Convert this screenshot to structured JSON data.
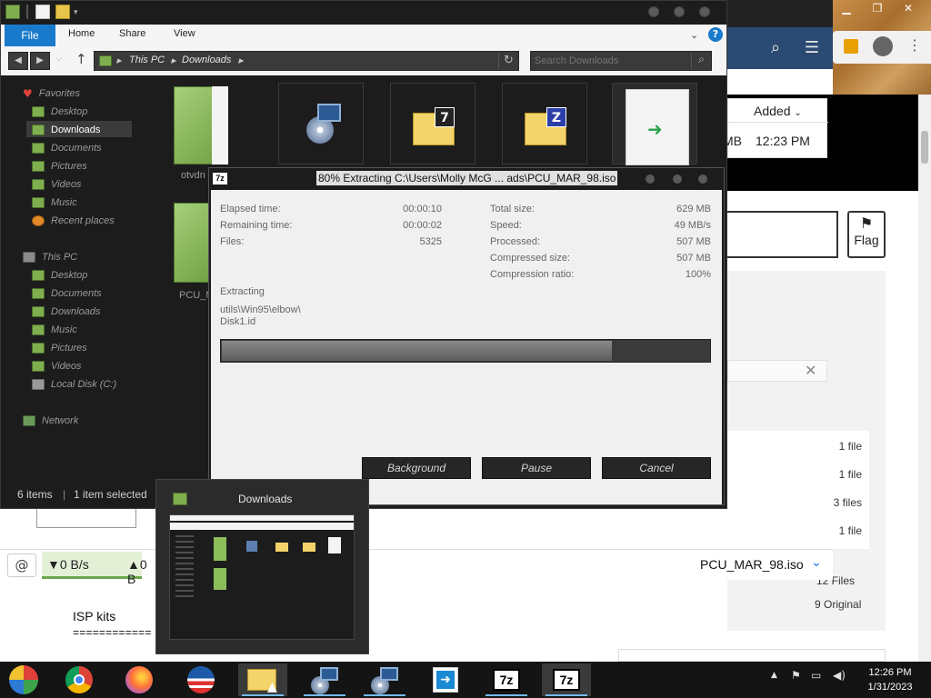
{
  "browser": {
    "added_header": "Added",
    "size_fragment": "MB",
    "added_time": "12:23 PM",
    "flag_label": "Flag",
    "file_counts": [
      "1 file",
      "1 file",
      "3 files",
      "1 file"
    ],
    "totals_files": "12 Files",
    "totals_original": "9 Original",
    "isp_text": "ISP kits",
    "isp_rule": "============",
    "download_bar": {
      "down_speed": "▼0 B/s",
      "up_speed": "▲0 B",
      "file_name": "PCU_MAR_98.iso"
    }
  },
  "explorer": {
    "ribbon_tabs": {
      "file": "File",
      "home": "Home",
      "share": "Share",
      "view": "View"
    },
    "help_label": "?",
    "address": {
      "root": "This PC",
      "folder": "Downloads"
    },
    "search_placeholder": "Search Downloads",
    "nav": {
      "favorites": "Favorites",
      "desktop": "Desktop",
      "downloads": "Downloads",
      "documents": "Documents",
      "pictures": "Pictures",
      "videos": "Videos",
      "music": "Music",
      "recent": "Recent places",
      "this_pc": "This PC",
      "pc_desktop": "Desktop",
      "pc_documents": "Documents",
      "pc_downloads": "Downloads",
      "pc_music": "Music",
      "pc_pictures": "Pictures",
      "pc_videos": "Videos",
      "local_disk": "Local Disk (C:)",
      "network": "Network"
    },
    "tiles": {
      "label1": "otvdn",
      "label2": "PCU_M"
    },
    "status": {
      "items": "6 items",
      "selected": "1 item selected"
    }
  },
  "dialog": {
    "logo": "7z",
    "caption": "80% Extracting C:\\Users\\Molly McG ... ads\\PCU_MAR_98.iso",
    "elapsed_label": "Elapsed time:",
    "elapsed_value": "00:00:10",
    "remaining_label": "Remaining time:",
    "remaining_value": "00:00:02",
    "files_label": "Files:",
    "files_value": "5325",
    "total_label": "Total size:",
    "total_value": "629 MB",
    "speed_label": "Speed:",
    "speed_value": "49 MB/s",
    "processed_label": "Processed:",
    "processed_value": "507 MB",
    "compressed_label": "Compressed size:",
    "compressed_value": "507 MB",
    "ratio_label": "Compression ratio:",
    "ratio_value": "100%",
    "extracting_label": "Extracting",
    "current_path": "utils\\Win95\\elbow\\",
    "current_file": "Disk1.id",
    "progress": 0.8,
    "buttons": {
      "background": "Background",
      "pause": "Pause",
      "cancel": "Cancel"
    }
  },
  "preview": {
    "title": "Downloads"
  },
  "taskbar": {
    "items": [
      "start-orb",
      "chrome",
      "firefox",
      "obama-logo",
      "file-explorer",
      "setup-cd",
      "setup-cd",
      "installer-arrow",
      "7zip",
      "7zip"
    ],
    "seven_zip_label": "7z",
    "time": "12:26 PM",
    "date": "1/31/2023"
  },
  "colors": {
    "accent": "#1979ca",
    "explorer_bg": "#1c1c1c",
    "folder_green": "#7fae4f",
    "taskbar_bg": "#141414"
  }
}
